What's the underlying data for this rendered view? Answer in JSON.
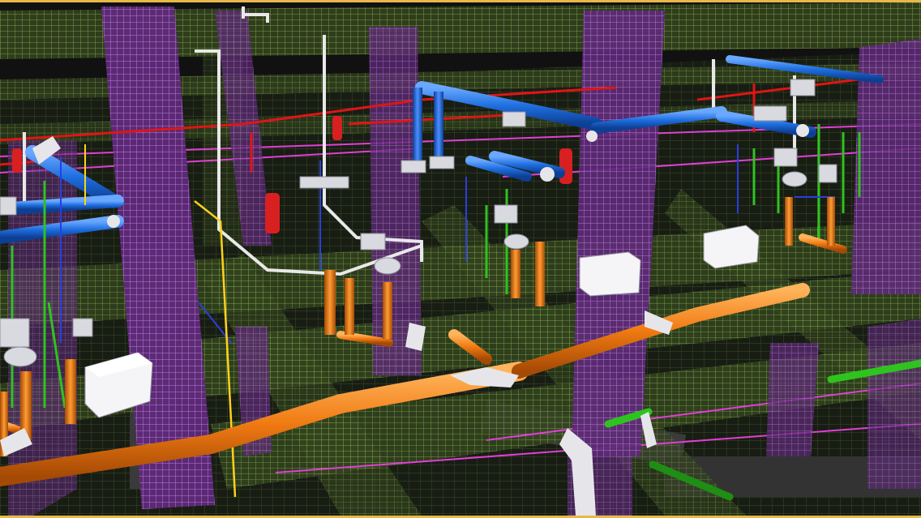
{
  "scene": {
    "kind": "3D BIM model render — MEP services (plumbing, drainage, HVAC, fire) coordinated with reinforced concrete rebar cages",
    "colors": {
      "background": "#000000",
      "frame_border": "#e8b84a",
      "rebar_cage_column": "#a34fd0",
      "rebar_cage_beam": "#7fae3a",
      "rebar_cage_slab": "#5f8a2c",
      "drainage_pipe_orange": "#f07a12",
      "water_pipe_blue": "#1f6fe0",
      "fire_pipe_red": "#e01515",
      "pipe_green": "#2ec31f",
      "pipe_white": "#e8e8e8",
      "fixture_white": "#f2f2f6",
      "electrical_yellow": "#ffd21a"
    },
    "visible_text": []
  }
}
